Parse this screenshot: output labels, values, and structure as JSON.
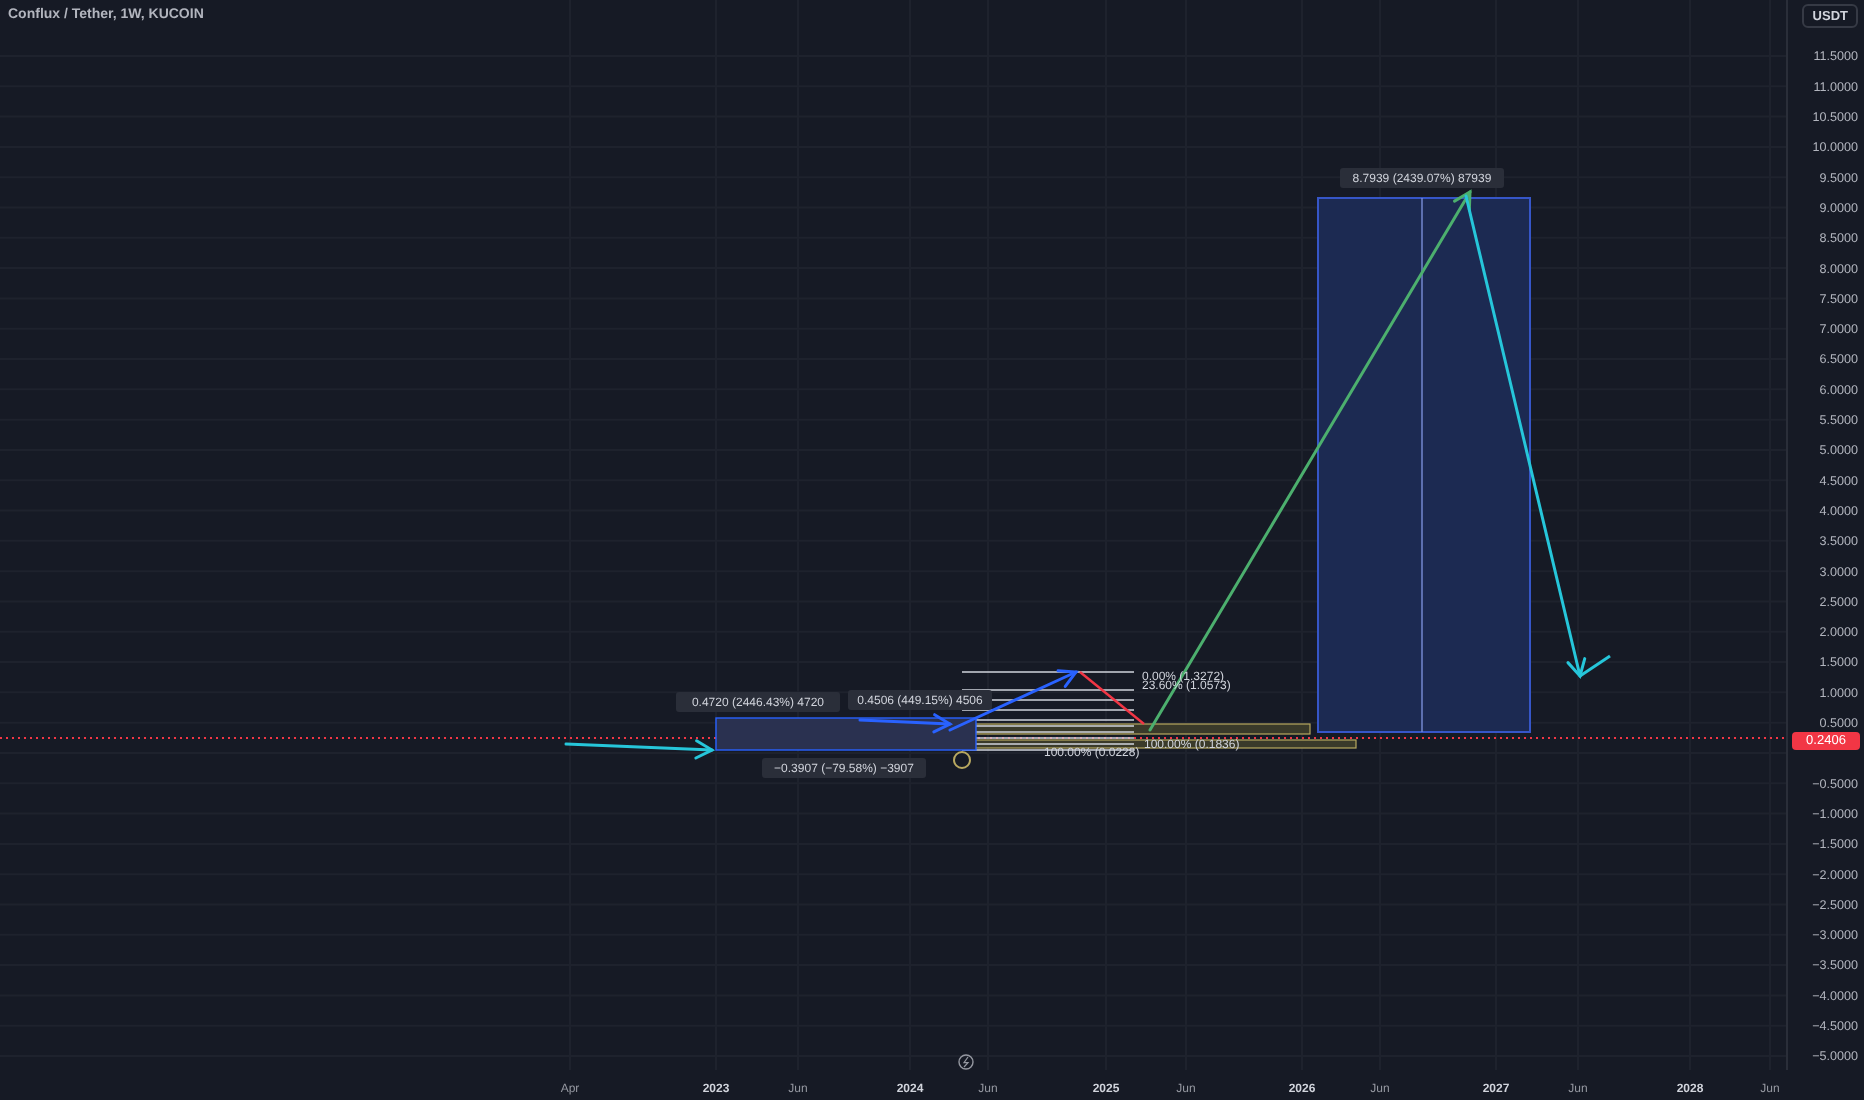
{
  "chart_title": "Conflux / Tether, 1W, KUCOIN",
  "currency_button": "USDT",
  "price_axis": [
    "11.5000",
    "11.0000",
    "10.5000",
    "10.0000",
    "9.5000",
    "9.0000",
    "8.5000",
    "8.0000",
    "7.5000",
    "7.0000",
    "6.5000",
    "6.0000",
    "5.5000",
    "5.0000",
    "4.5000",
    "4.0000",
    "3.5000",
    "3.0000",
    "2.5000",
    "2.0000",
    "1.5000",
    "1.0000",
    "0.5000",
    "−0.5000",
    "−1.0000",
    "−1.5000",
    "−2.0000",
    "−2.5000",
    "−3.0000",
    "−3.5000",
    "−4.0000",
    "−4.5000",
    "−5.0000"
  ],
  "current_price": "0.2406",
  "time_axis": [
    {
      "label": "Apr",
      "kind": "month"
    },
    {
      "label": "2023",
      "kind": "year"
    },
    {
      "label": "Jun",
      "kind": "month"
    },
    {
      "label": "2024",
      "kind": "year"
    },
    {
      "label": "Jun",
      "kind": "month"
    },
    {
      "label": "2025",
      "kind": "year"
    },
    {
      "label": "Jun",
      "kind": "month"
    },
    {
      "label": "2026",
      "kind": "year"
    },
    {
      "label": "Jun",
      "kind": "month"
    },
    {
      "label": "2027",
      "kind": "year"
    },
    {
      "label": "Jun",
      "kind": "month"
    },
    {
      "label": "2028",
      "kind": "year"
    },
    {
      "label": "Jun",
      "kind": "month"
    }
  ],
  "measure_labels": [
    "8.7939 (2439.07%) 87939",
    "0.4720 (2446.43%) 4720",
    "0.4506 (449.15%) 4506",
    "−0.3907 (−79.58%) −3907"
  ],
  "fib_labels": [
    "0.00% (1.3272)",
    "23.60% (1.0573)",
    "100.00% (0.1836)",
    "100.00% (0.0228)"
  ]
}
